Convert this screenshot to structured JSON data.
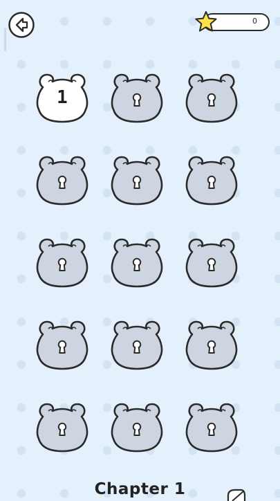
{
  "header": {
    "back_icon": "arrow-left-icon",
    "star_icon": "star-icon",
    "star_count": "0"
  },
  "levels": [
    {
      "number": "1",
      "state": "unlocked"
    },
    {
      "number": "",
      "state": "locked"
    },
    {
      "number": "",
      "state": "locked"
    },
    {
      "number": "",
      "state": "locked"
    },
    {
      "number": "",
      "state": "locked"
    },
    {
      "number": "",
      "state": "locked"
    },
    {
      "number": "",
      "state": "locked"
    },
    {
      "number": "",
      "state": "locked"
    },
    {
      "number": "",
      "state": "locked"
    },
    {
      "number": "",
      "state": "locked"
    },
    {
      "number": "",
      "state": "locked"
    },
    {
      "number": "",
      "state": "locked"
    },
    {
      "number": "",
      "state": "locked"
    },
    {
      "number": "",
      "state": "locked"
    },
    {
      "number": "",
      "state": "locked"
    }
  ],
  "footer": {
    "chapter_title": "Chapter 1",
    "edge_icon": "partial-icon"
  },
  "colors": {
    "background": "#e4f0fb",
    "locked_fill": "#cdd6e0",
    "unlocked_fill": "#ffffff",
    "outline": "#2a2a2a",
    "star": "#ffe14d"
  }
}
